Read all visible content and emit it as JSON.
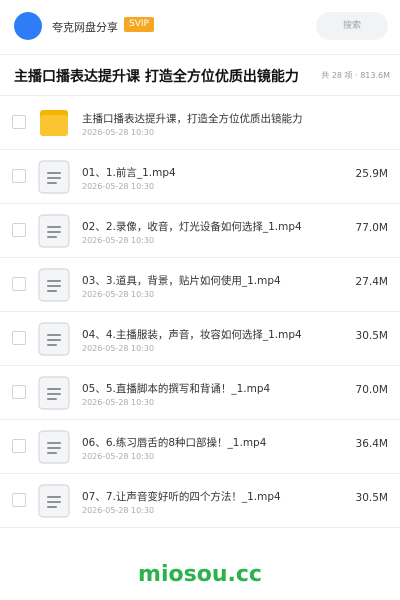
{
  "header": {
    "brand": "夸克网盘分享",
    "badge": "SVIP",
    "search_placeholder": "搜索"
  },
  "page": {
    "title": "主播口播表达提升课 打造全方位优质出镜能力",
    "summary": "共 28 项 · 813.6M"
  },
  "files": [
    {
      "type": "folder-icon",
      "name": "主播口播表达提升课，打造全方位优质出镜能力",
      "date": "2026-05-28 10:30",
      "size": ""
    },
    {
      "type": "file-icon",
      "name": "01、1.前言_1.mp4",
      "date": "2026-05-28 10:30",
      "size": "25.9M"
    },
    {
      "type": "file-icon",
      "name": "02、2.录像，收音，灯光设备如何选择_1.mp4",
      "date": "2026-05-28 10:30",
      "size": "77.0M"
    },
    {
      "type": "file-icon",
      "name": "03、3.道具，背景，贴片如何使用_1.mp4",
      "date": "2026-05-28 10:30",
      "size": "27.4M"
    },
    {
      "type": "file-icon",
      "name": "04、4.主播服装，声音，妆容如何选择_1.mp4",
      "date": "2026-05-28 10:30",
      "size": "30.5M"
    },
    {
      "type": "file-icon",
      "name": "05、5.直播脚本的撰写和背诵！_1.mp4",
      "date": "2026-05-28 10:30",
      "size": "70.0M"
    },
    {
      "type": "file-icon",
      "name": "06、6.练习唇舌的8种口部操！_1.mp4",
      "date": "2026-05-28 10:30",
      "size": "36.4M"
    },
    {
      "type": "file-icon",
      "name": "07、7.让声音变好听的四个方法！_1.mp4",
      "date": "2026-05-28 10:30",
      "size": "30.5M"
    }
  ],
  "watermark": "miosou.cc",
  "colors": {
    "accent": "#2f7df6",
    "badge": "#f5a623",
    "folder": "#fbc531",
    "watermark": "#2bb24c"
  }
}
